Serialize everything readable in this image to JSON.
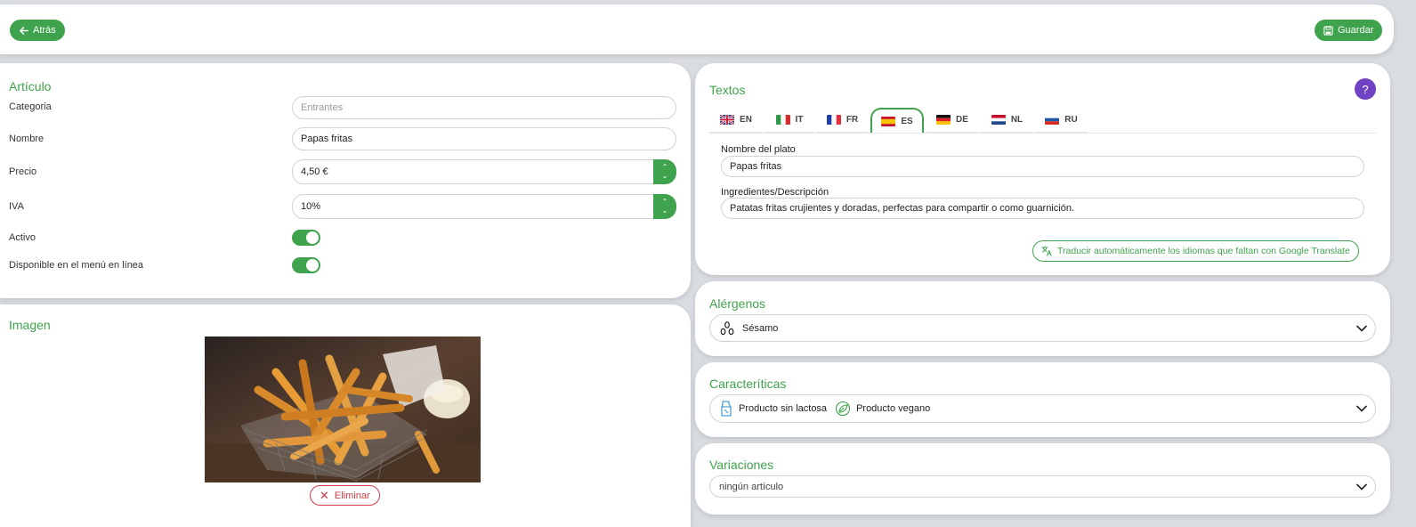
{
  "header": {
    "back_label": "Atrás",
    "save_label": "Guardar"
  },
  "article": {
    "title": "Artículo",
    "category_label": "Categoria",
    "category_placeholder": "Entrantes",
    "name_label": "Nombre",
    "name_value": "Papas fritas",
    "price_label": "Precio",
    "price_value": "4,50 €",
    "vat_label": "IVA",
    "vat_value": "10%",
    "active_label": "Activo",
    "active_on": true,
    "online_label": "Disponible en el menú en línea",
    "online_on": true
  },
  "image": {
    "title": "Imagen",
    "delete_label": "Eliminar"
  },
  "texts": {
    "title": "Textos",
    "help_label": "?",
    "tabs": [
      {
        "code": "EN",
        "flag": "uk-flag-icon"
      },
      {
        "code": "IT",
        "flag": "italy-flag-icon"
      },
      {
        "code": "FR",
        "flag": "france-flag-icon"
      },
      {
        "code": "ES",
        "flag": "spain-flag-icon"
      },
      {
        "code": "DE",
        "flag": "germany-flag-icon"
      },
      {
        "code": "NL",
        "flag": "netherlands-flag-icon"
      },
      {
        "code": "RU",
        "flag": "russia-flag-icon"
      }
    ],
    "active_tab": "ES",
    "dish_name_label": "Nombre del plato",
    "dish_name_value": "Papas fritas",
    "description_label": "Ingredientes/Descripción",
    "description_value": "Patatas fritas crujientes y doradas, perfectas para compartir o como guarnición.",
    "translate_label": "Traducir automáticamente los idiomas que faltan con Google Translate"
  },
  "allergens": {
    "title": "Alérgenos",
    "selected": "Sésamo",
    "icon": "sesame-icon"
  },
  "features": {
    "title": "Caracteríticas",
    "items": [
      {
        "label": "Producto sin lactosa",
        "icon": "milk-carton-icon"
      },
      {
        "label": "Producto vegano",
        "icon": "vegan-leaf-icon"
      }
    ]
  },
  "variations": {
    "title": "Variaciones",
    "value": "ningún artículo"
  },
  "colors": {
    "accent": "#3fa34d",
    "danger": "#d33b45",
    "help": "#6f42c1",
    "background": "#d9dce1"
  }
}
